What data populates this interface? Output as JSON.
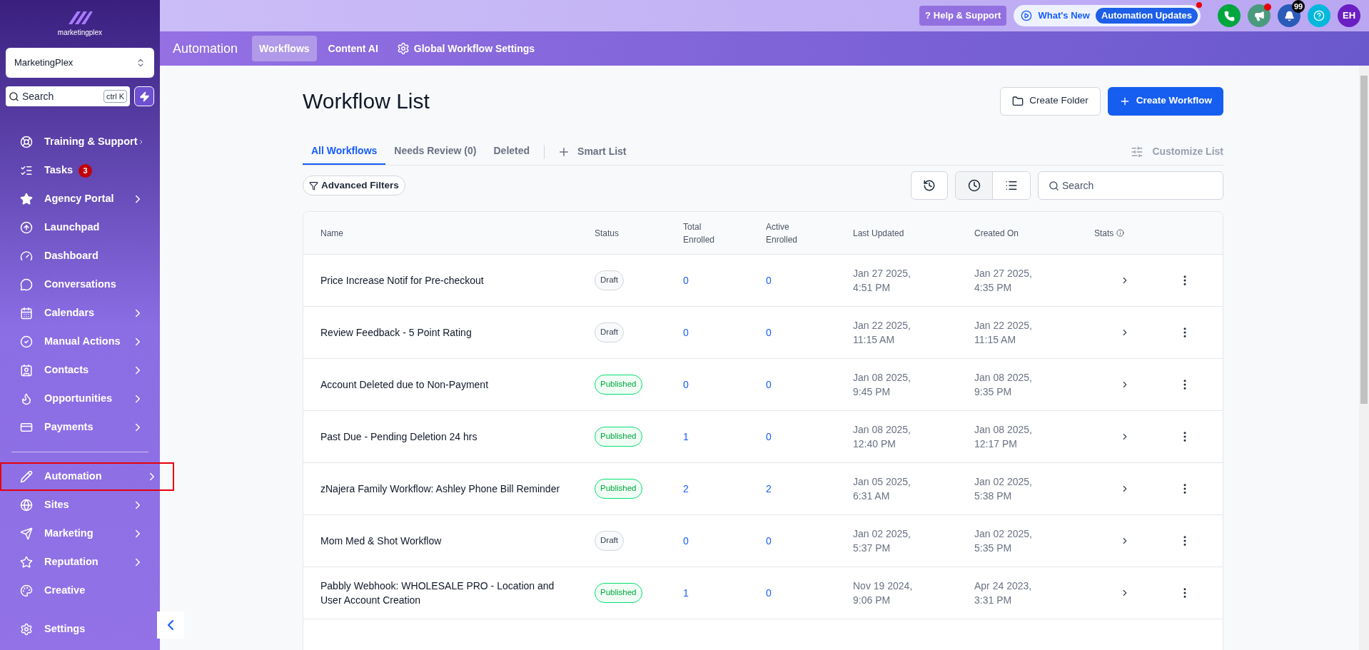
{
  "sidebar": {
    "logo": "marketingplex",
    "account": "MarketingPlex",
    "search": {
      "placeholder": "Search",
      "shortcut": "ctrl K"
    },
    "groups": [
      {
        "items": [
          {
            "label": "Training & Support",
            "submenu": true,
            "highlighted": false
          },
          {
            "label": "Tasks",
            "submenu": false,
            "badge": "3",
            "highlighted": false
          },
          {
            "label": "Agency Portal",
            "submenu": true,
            "highlighted": false
          },
          {
            "label": "Launchpad",
            "submenu": false,
            "highlighted": false
          },
          {
            "label": "Dashboard",
            "submenu": false,
            "highlighted": false
          },
          {
            "label": "Conversations",
            "submenu": false,
            "highlighted": false
          },
          {
            "label": "Calendars",
            "submenu": true,
            "highlighted": false
          },
          {
            "label": "Manual Actions",
            "submenu": true,
            "highlighted": false
          },
          {
            "label": "Contacts",
            "submenu": true,
            "highlighted": false
          },
          {
            "label": "Opportunities",
            "submenu": true,
            "highlighted": false
          },
          {
            "label": "Payments",
            "submenu": true,
            "highlighted": false
          }
        ]
      },
      {
        "items": [
          {
            "label": "Automation",
            "submenu": true,
            "highlighted": true
          },
          {
            "label": "Sites",
            "submenu": true,
            "highlighted": false
          },
          {
            "label": "Marketing",
            "submenu": true,
            "highlighted": false
          },
          {
            "label": "Reputation",
            "submenu": true,
            "highlighted": false
          },
          {
            "label": "Creative",
            "submenu": false,
            "highlighted": false
          }
        ]
      }
    ],
    "settings": "Settings"
  },
  "topbar": {
    "help_icon": "?",
    "help": "Help & Support",
    "whats_new": "What's New",
    "updates": "Automation Updates",
    "notifications": "99",
    "avatar": "EH"
  },
  "nav": {
    "title": "Automation",
    "tabs": [
      {
        "label": "Workflows",
        "selected": true
      },
      {
        "label": "Content AI",
        "selected": false
      },
      {
        "label": "Global Workflow Settings",
        "selected": false
      }
    ]
  },
  "page": {
    "title": "Workflow List",
    "create_folder": "Create Folder",
    "create_workflow": "Create Workflow",
    "tabs": [
      {
        "label": "All Workflows",
        "selected": true
      },
      {
        "label": "Needs Review (0)",
        "selected": false
      },
      {
        "label": "Deleted",
        "selected": false
      }
    ],
    "smart_list": "Smart List",
    "customize": "Customize List",
    "filters": "Advanced Filters",
    "search": {
      "placeholder": "Search"
    }
  },
  "table": {
    "columns": [
      "Name",
      "Status",
      "Total Enrolled",
      "Active Enrolled",
      "Last Updated",
      "Created On",
      "Stats"
    ],
    "rows": [
      {
        "name": "Price Increase Notif for Pre-checkout",
        "status": {
          "kind": "draft",
          "label": "Draft"
        },
        "total": "0",
        "active": "0",
        "updated": "Jan 27 2025, 4:51 PM",
        "created": "Jan 27 2025, 4:35 PM"
      },
      {
        "name": "Review Feedback - 5 Point Rating",
        "status": {
          "kind": "draft",
          "label": "Draft"
        },
        "total": "0",
        "active": "0",
        "updated": "Jan 22 2025, 11:15 AM",
        "created": "Jan 22 2025, 11:15 AM"
      },
      {
        "name": "Account Deleted due to Non-Payment",
        "status": {
          "kind": "published",
          "label": "Published"
        },
        "total": "0",
        "active": "0",
        "updated": "Jan 08 2025, 9:45 PM",
        "created": "Jan 08 2025, 9:35 PM"
      },
      {
        "name": "Past Due - Pending Deletion 24 hrs",
        "status": {
          "kind": "published",
          "label": "Published"
        },
        "total": "1",
        "active": "0",
        "updated": "Jan 08 2025, 12:40 PM",
        "created": "Jan 08 2025, 12:17 PM"
      },
      {
        "name": "zNajera Family Workflow:  Ashley Phone Bill Reminder",
        "status": {
          "kind": "published",
          "label": "Published"
        },
        "total": "2",
        "active": "2",
        "updated": "Jan 05 2025, 6:31 AM",
        "created": "Jan 02 2025, 5:38 PM"
      },
      {
        "name": "Mom Med & Shot Workflow",
        "status": {
          "kind": "draft",
          "label": "Draft"
        },
        "total": "0",
        "active": "0",
        "updated": "Jan 02 2025, 5:37 PM",
        "created": "Jan 02 2025, 5:35 PM"
      },
      {
        "name": "Pabbly Webhook:  WHOLESALE PRO - Location and User Account Creation",
        "status": {
          "kind": "published",
          "label": "Published"
        },
        "total": "1",
        "active": "0",
        "updated": "Nov 19 2024, 9:06 PM",
        "created": "Apr 24 2023, 3:31 PM"
      }
    ]
  }
}
